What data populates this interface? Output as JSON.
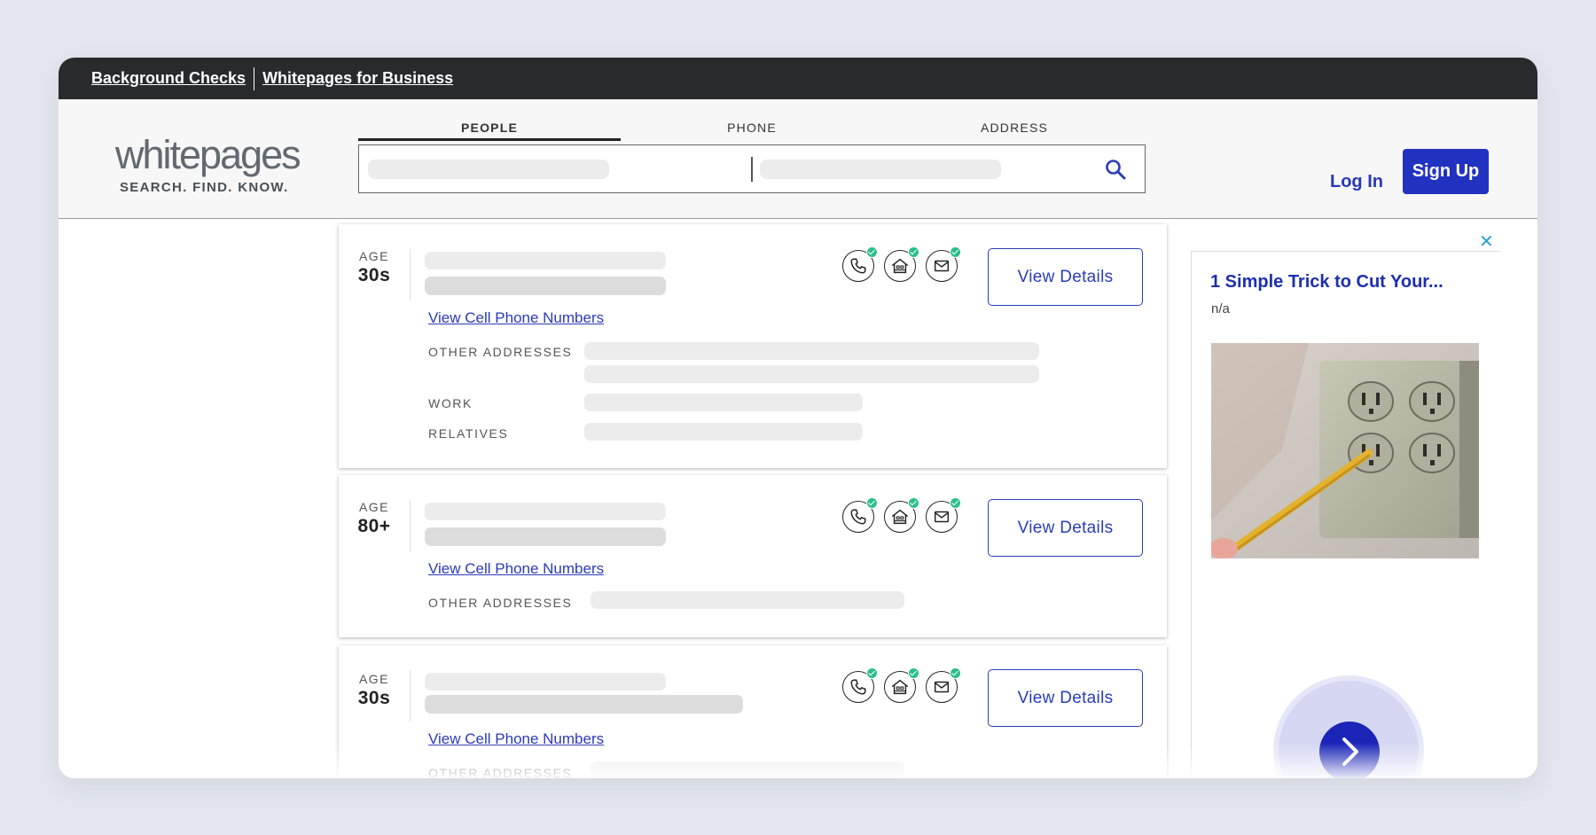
{
  "topbar": {
    "link1": "Background Checks",
    "link2": "Whitepages for Business"
  },
  "logo": {
    "word": "whitepages",
    "tagline": "SEARCH. FIND. KNOW."
  },
  "search": {
    "tabs": [
      "PEOPLE",
      "PHONE",
      "ADDRESS"
    ],
    "active_tab": "PEOPLE"
  },
  "auth": {
    "login": "Log In",
    "signup": "Sign Up"
  },
  "results": [
    {
      "age_label": "AGE",
      "age": "30s",
      "cell_link": "View Cell Phone Numbers",
      "fields": [
        "OTHER ADDRESSES",
        "WORK",
        "RELATIVES"
      ],
      "button": "View Details"
    },
    {
      "age_label": "AGE",
      "age": "80+",
      "cell_link": "View Cell Phone Numbers",
      "fields": [
        "OTHER ADDRESSES"
      ],
      "button": "View Details"
    },
    {
      "age_label": "AGE",
      "age": "30s",
      "cell_link": "View Cell Phone Numbers",
      "fields": [
        "OTHER ADDRESSES"
      ],
      "button": "View Details"
    }
  ],
  "icons": [
    "phone-icon",
    "home-icon",
    "email-icon",
    "search-icon",
    "close-icon",
    "chevron-right-icon"
  ],
  "ad": {
    "close": "✕",
    "title": "1 Simple Trick to Cut Your...",
    "sub": "n/a"
  },
  "colors": {
    "brand_blue": "#2132c1",
    "topbar": "#282a2b",
    "check_green": "#2bbf8b"
  }
}
